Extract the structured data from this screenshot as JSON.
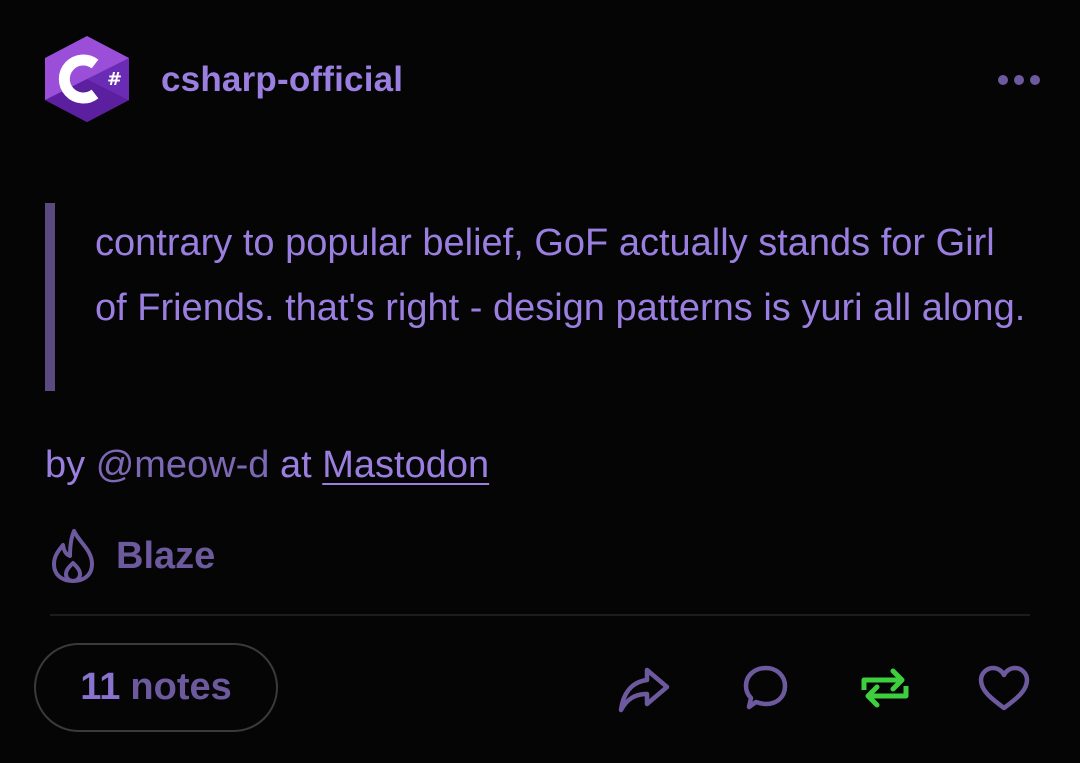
{
  "post": {
    "blog_name": "csharp-official",
    "avatar_glyph": "C#",
    "quote": "contrary to popular belief, GoF actually stands for Girl of Friends. that's right - design patterns is yuri all along.",
    "byline": {
      "prefix": "by",
      "handle": "@meow-d",
      "middle": "at",
      "link": "Mastodon"
    },
    "blaze_label": "Blaze",
    "notes": {
      "count": "11",
      "label": "notes"
    }
  },
  "icons": {
    "more": "more-horizontal-icon",
    "blaze": "flame-icon",
    "share": "share-arrow-icon",
    "reply": "comment-bubble-icon",
    "reblog": "reblog-icon",
    "like": "heart-icon"
  },
  "colors": {
    "background": "#050505",
    "accent": "#9a7ee0",
    "muted": "#6d5a9e",
    "reblog": "#3ecf3e"
  }
}
